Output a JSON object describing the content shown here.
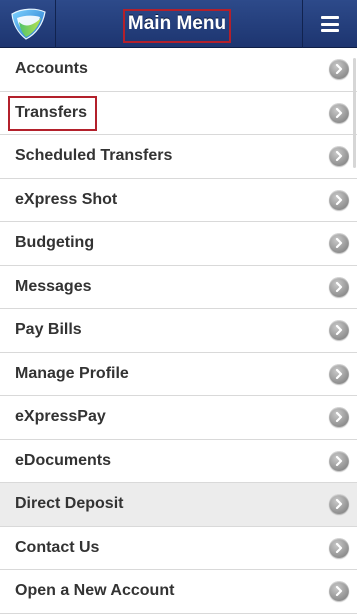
{
  "header": {
    "title": "Main Menu",
    "logo_icon": "bank-logo-icon",
    "menu_icon": "hamburger-icon",
    "bar_color": "#2d4a8a",
    "highlight_color": "#b3202b"
  },
  "menu": {
    "items": [
      {
        "label": "Accounts"
      },
      {
        "label": "Transfers"
      },
      {
        "label": "Scheduled Transfers"
      },
      {
        "label": "eXpress Shot"
      },
      {
        "label": "Budgeting"
      },
      {
        "label": "Messages"
      },
      {
        "label": "Pay Bills"
      },
      {
        "label": "Manage Profile"
      },
      {
        "label": "eXpressPay"
      },
      {
        "label": "eDocuments"
      },
      {
        "label": "Direct Deposit"
      },
      {
        "label": "Contact Us"
      },
      {
        "label": "Open a New Account"
      }
    ],
    "chevron_icon": "chevron-right-icon"
  }
}
